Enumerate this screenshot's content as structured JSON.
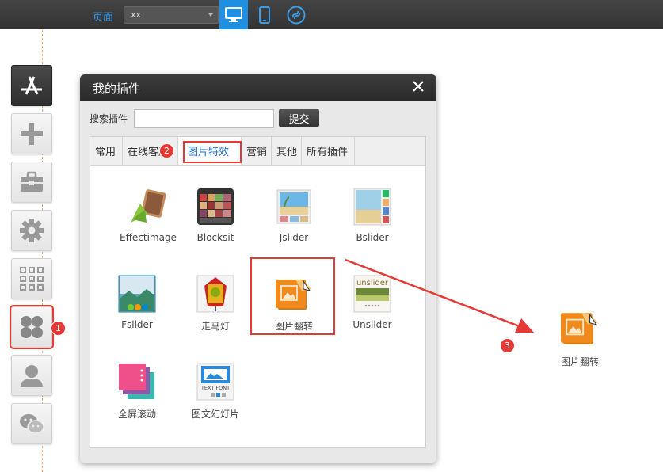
{
  "topbar": {
    "page_label": "页面",
    "page_select_value": "xx",
    "devices": [
      "desktop-icon",
      "mobile-icon",
      "mini-program-icon"
    ]
  },
  "sidebar": {
    "items": [
      "app-store-icon",
      "add-icon",
      "toolbox-icon",
      "settings-icon",
      "grid-icon",
      "plugins-icon",
      "user-icon",
      "wechat-icon"
    ],
    "active_badge": "1"
  },
  "dialog": {
    "title": "我的插件",
    "search_label": "搜索插件",
    "search_value": "",
    "search_button": "提交",
    "tabs": [
      {
        "label": "常用"
      },
      {
        "label": "在线客服"
      },
      {
        "label": "图片特效",
        "active": true
      },
      {
        "label": "营销"
      },
      {
        "label": "其他"
      },
      {
        "label": "所有插件"
      }
    ],
    "tab_badge": "2",
    "plugins": [
      {
        "name": "Effectimage"
      },
      {
        "name": "Blocksit"
      },
      {
        "name": "Jslider"
      },
      {
        "name": "Bslider"
      },
      {
        "name": "Fslider"
      },
      {
        "name": "走马灯"
      },
      {
        "name": "图片翻转"
      },
      {
        "name": "Unslider"
      },
      {
        "name": "全屏滚动"
      },
      {
        "name": "图文幻灯片"
      }
    ],
    "unslider_text": "unslider",
    "textfont_text": "TEXT FONT"
  },
  "drop": {
    "badge": "3",
    "name": "图片翻转"
  },
  "colors": {
    "accent": "#1e8fe1",
    "highlight": "#e53935",
    "orange": "#f08a1c"
  }
}
